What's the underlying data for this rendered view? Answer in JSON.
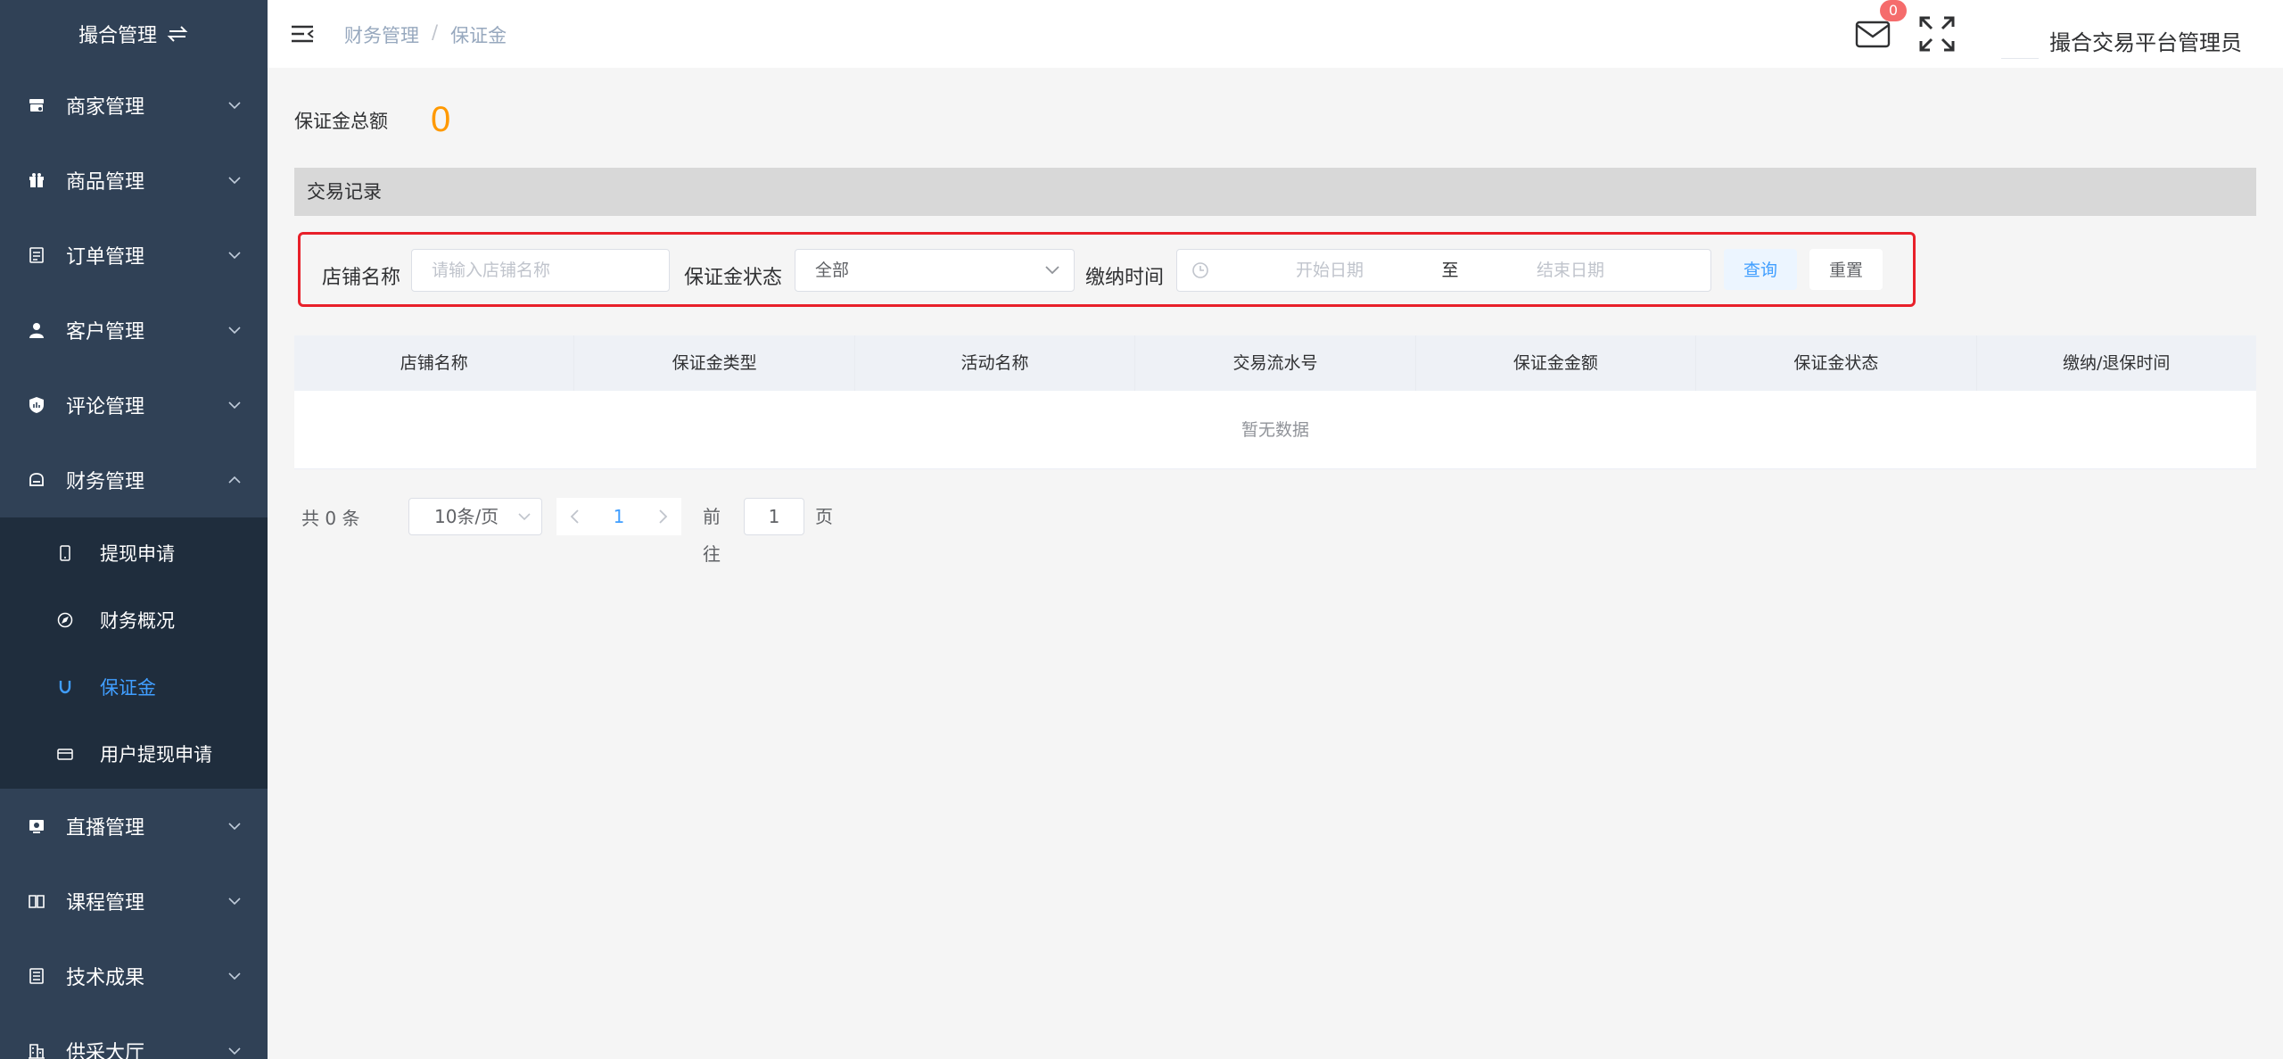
{
  "app": {
    "title": "撮合管理"
  },
  "sidebar": {
    "items": [
      {
        "label": "商家管理",
        "icon": "store-icon"
      },
      {
        "label": "商品管理",
        "icon": "gift-icon"
      },
      {
        "label": "订单管理",
        "icon": "document-icon"
      },
      {
        "label": "客户管理",
        "icon": "user-icon"
      },
      {
        "label": "评论管理",
        "icon": "comment-shield-icon"
      },
      {
        "label": "财务管理",
        "icon": "finance-icon",
        "expanded": true
      }
    ],
    "sub_items": [
      {
        "label": "提现申请",
        "icon": "phone-icon"
      },
      {
        "label": "财务概况",
        "icon": "compass-icon"
      },
      {
        "label": "保证金",
        "icon": "magnet-icon",
        "active": true
      },
      {
        "label": "用户提现申请",
        "icon": "card-icon"
      }
    ],
    "items_after": [
      {
        "label": "直播管理",
        "icon": "live-icon"
      },
      {
        "label": "课程管理",
        "icon": "book-icon"
      },
      {
        "label": "技术成果",
        "icon": "list-icon"
      },
      {
        "label": "供采大厅",
        "icon": "building-icon"
      }
    ]
  },
  "header": {
    "breadcrumb": [
      "财务管理",
      "保证金"
    ],
    "breadcrumb_sep": "/",
    "mail_badge": "0",
    "username": "撮合交易平台管理员"
  },
  "main": {
    "total_label": "保证金总额",
    "total_value": "0",
    "section_title": "交易记录",
    "filters": {
      "shop_label": "店铺名称",
      "shop_placeholder": "请输入店铺名称",
      "status_label": "保证金状态",
      "status_value": "全部",
      "time_label": "缴纳时间",
      "start_placeholder": "开始日期",
      "range_sep": "至",
      "end_placeholder": "结束日期",
      "query_button": "查询",
      "reset_button": "重置"
    },
    "table": {
      "columns": [
        "店铺名称",
        "保证金类型",
        "活动名称",
        "交易流水号",
        "保证金金额",
        "保证金状态",
        "缴纳/退保时间"
      ],
      "empty_text": "暂无数据"
    },
    "pagination": {
      "total_text": "共 0 条",
      "page_size": "10条/页",
      "current_page": "1",
      "goto_label": "前往",
      "goto_value": "1",
      "page_suffix": "页"
    }
  },
  "colors": {
    "sidebar_bg": "#304156",
    "submenu_bg": "#1f2d3d",
    "accent": "#409eff",
    "total_value": "#ff9900",
    "badge": "#f56c6c",
    "highlight_border": "#e8202a"
  }
}
